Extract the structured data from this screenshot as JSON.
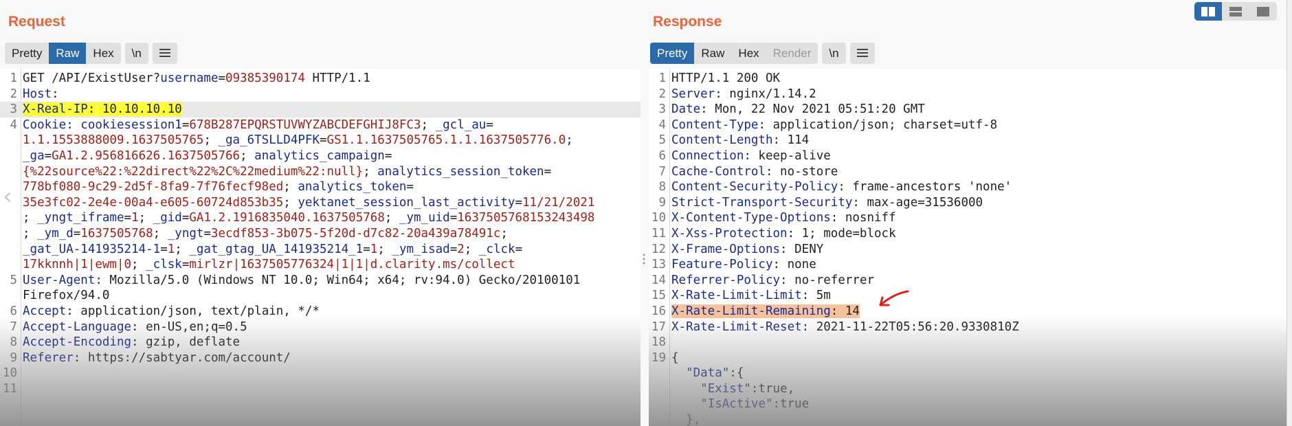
{
  "request": {
    "title": "Request",
    "tabs": [
      {
        "label": "Pretty",
        "active": false
      },
      {
        "label": "Raw",
        "active": true
      },
      {
        "label": "Hex",
        "active": false
      }
    ],
    "newline_button": "\\n",
    "menu_icon": "hamburger-menu-icon",
    "lines": [
      {
        "n": "1",
        "parts": [
          [
            "p",
            "GET /API/ExistUser?"
          ],
          [
            "k",
            "username"
          ],
          [
            "p",
            "="
          ],
          [
            "v",
            "09385390174"
          ],
          [
            "p",
            " HTTP/1.1"
          ]
        ]
      },
      {
        "n": "2",
        "parts": [
          [
            "k",
            "Host"
          ],
          [
            "p",
            ":"
          ]
        ]
      },
      {
        "n": "3",
        "cur": true,
        "highlight": "yellow",
        "parts": [
          [
            "k",
            "X-Real-IP"
          ],
          [
            "p",
            ": 10.10.10.10"
          ]
        ]
      },
      {
        "n": "4",
        "parts": [
          [
            "k",
            "Cookie"
          ],
          [
            "p",
            ": "
          ],
          [
            "k",
            "cookiesession1"
          ],
          [
            "p",
            "="
          ],
          [
            "v",
            "678B287EPQRSTUVWYZABCDEFGHIJ8FC3"
          ],
          [
            "p",
            "; "
          ],
          [
            "k",
            "_gcl_au"
          ],
          [
            "p",
            "="
          ]
        ]
      },
      {
        "n": "",
        "parts": [
          [
            "v",
            "1.1.1553888009.1637505765"
          ],
          [
            "p",
            "; "
          ],
          [
            "k",
            "_ga_6TSLLD4PFK"
          ],
          [
            "p",
            "="
          ],
          [
            "v",
            "GS1.1.1637505765.1.1.1637505776.0"
          ],
          [
            "p",
            ";"
          ]
        ]
      },
      {
        "n": "",
        "parts": [
          [
            "k",
            "_ga"
          ],
          [
            "p",
            "="
          ],
          [
            "v",
            "GA1.2.956816626.1637505766"
          ],
          [
            "p",
            "; "
          ],
          [
            "k",
            "analytics_campaign"
          ],
          [
            "p",
            "="
          ]
        ]
      },
      {
        "n": "",
        "parts": [
          [
            "v",
            "{%22source%22:%22direct%22%2C%22medium%22:null}"
          ],
          [
            "p",
            "; "
          ],
          [
            "k",
            "analytics_session_token"
          ],
          [
            "p",
            "="
          ]
        ]
      },
      {
        "n": "",
        "parts": [
          [
            "v",
            "778bf080-9c29-2d5f-8fa9-7f76fecf98ed"
          ],
          [
            "p",
            "; "
          ],
          [
            "k",
            "analytics_token"
          ],
          [
            "p",
            "="
          ]
        ]
      },
      {
        "n": "",
        "parts": [
          [
            "v",
            "35e3fc02-2e4e-00a4-e605-60724d853b35"
          ],
          [
            "p",
            "; "
          ],
          [
            "k",
            "yektanet_session_last_activity"
          ],
          [
            "p",
            "="
          ],
          [
            "v",
            "11/21/2021"
          ]
        ]
      },
      {
        "n": "",
        "parts": [
          [
            "p",
            "; "
          ],
          [
            "k",
            "_yngt_iframe"
          ],
          [
            "p",
            "="
          ],
          [
            "v",
            "1"
          ],
          [
            "p",
            "; "
          ],
          [
            "k",
            "_gid"
          ],
          [
            "p",
            "="
          ],
          [
            "v",
            "GA1.2.1916835040.1637505768"
          ],
          [
            "p",
            "; "
          ],
          [
            "k",
            "_ym_uid"
          ],
          [
            "p",
            "="
          ],
          [
            "v",
            "1637505768153243498"
          ]
        ]
      },
      {
        "n": "",
        "parts": [
          [
            "p",
            "; "
          ],
          [
            "k",
            "_ym_d"
          ],
          [
            "p",
            "="
          ],
          [
            "v",
            "1637505768"
          ],
          [
            "p",
            "; "
          ],
          [
            "k",
            "_yngt"
          ],
          [
            "p",
            "="
          ],
          [
            "v",
            "3ecdf853-3b075-5f20d-d7c82-20a439a78491c"
          ],
          [
            "p",
            ";"
          ]
        ]
      },
      {
        "n": "",
        "parts": [
          [
            "k",
            "_gat_UA-141935214-1"
          ],
          [
            "p",
            "="
          ],
          [
            "v",
            "1"
          ],
          [
            "p",
            "; "
          ],
          [
            "k",
            "_gat_gtag_UA_141935214_1"
          ],
          [
            "p",
            "="
          ],
          [
            "v",
            "1"
          ],
          [
            "p",
            "; "
          ],
          [
            "k",
            "_ym_isad"
          ],
          [
            "p",
            "="
          ],
          [
            "v",
            "2"
          ],
          [
            "p",
            "; "
          ],
          [
            "k",
            "_clck"
          ],
          [
            "p",
            "="
          ]
        ]
      },
      {
        "n": "",
        "parts": [
          [
            "v",
            "17kknnh|1|ewm|0"
          ],
          [
            "p",
            "; "
          ],
          [
            "k",
            "_clsk"
          ],
          [
            "p",
            "="
          ],
          [
            "v",
            "mirlzr|1637505776324|1|1|d.clarity.ms/collect"
          ]
        ]
      },
      {
        "n": "5",
        "parts": [
          [
            "k",
            "User-Agent"
          ],
          [
            "p",
            ": Mozilla/5.0 (Windows NT 10.0; Win64; x64; rv:94.0) Gecko/20100101"
          ]
        ]
      },
      {
        "n": "",
        "parts": [
          [
            "p",
            "Firefox/94.0"
          ]
        ]
      },
      {
        "n": "6",
        "parts": [
          [
            "k",
            "Accept"
          ],
          [
            "p",
            ": application/json, text/plain, */*"
          ]
        ]
      },
      {
        "n": "7",
        "parts": [
          [
            "k",
            "Accept-Language"
          ],
          [
            "p",
            ": en-US,en;q=0.5"
          ]
        ]
      },
      {
        "n": "8",
        "parts": [
          [
            "k",
            "Accept-Encoding"
          ],
          [
            "p",
            ": gzip, deflate"
          ]
        ]
      },
      {
        "n": "9",
        "parts": [
          [
            "k",
            "Referer"
          ],
          [
            "p",
            ": https://sabtyar.com/account/"
          ]
        ]
      },
      {
        "n": "10",
        "parts": []
      },
      {
        "n": "11",
        "parts": []
      }
    ]
  },
  "response": {
    "title": "Response",
    "tabs": [
      {
        "label": "Pretty",
        "active": true
      },
      {
        "label": "Raw",
        "active": false
      },
      {
        "label": "Hex",
        "active": false
      },
      {
        "label": "Render",
        "active": false,
        "disabled": true
      }
    ],
    "newline_button": "\\n",
    "menu_icon": "hamburger-menu-icon",
    "lines": [
      {
        "n": "1",
        "parts": [
          [
            "p",
            "HTTP/1.1 200 OK"
          ]
        ]
      },
      {
        "n": "2",
        "parts": [
          [
            "k",
            "Server"
          ],
          [
            "p",
            ": nginx/1.14.2"
          ]
        ]
      },
      {
        "n": "3",
        "parts": [
          [
            "k",
            "Date"
          ],
          [
            "p",
            ": Mon, 22 Nov 2021 05:51:20 GMT"
          ]
        ]
      },
      {
        "n": "4",
        "parts": [
          [
            "k",
            "Content-Type"
          ],
          [
            "p",
            ": application/json; charset=utf-8"
          ]
        ]
      },
      {
        "n": "5",
        "parts": [
          [
            "k",
            "Content-Length"
          ],
          [
            "p",
            ": 114"
          ]
        ]
      },
      {
        "n": "6",
        "parts": [
          [
            "k",
            "Connection"
          ],
          [
            "p",
            ": keep-alive"
          ]
        ]
      },
      {
        "n": "7",
        "parts": [
          [
            "k",
            "Cache-Control"
          ],
          [
            "p",
            ": no-store"
          ]
        ]
      },
      {
        "n": "8",
        "parts": [
          [
            "k",
            "Content-Security-Policy"
          ],
          [
            "p",
            ": frame-ancestors 'none'"
          ]
        ]
      },
      {
        "n": "9",
        "parts": [
          [
            "k",
            "Strict-Transport-Security"
          ],
          [
            "p",
            ": max-age=31536000"
          ]
        ]
      },
      {
        "n": "10",
        "parts": [
          [
            "k",
            "X-Content-Type-Options"
          ],
          [
            "p",
            ": nosniff"
          ]
        ]
      },
      {
        "n": "11",
        "parts": [
          [
            "k",
            "X-Xss-Protection"
          ],
          [
            "p",
            ": 1; mode=block"
          ]
        ]
      },
      {
        "n": "12",
        "parts": [
          [
            "k",
            "X-Frame-Options"
          ],
          [
            "p",
            ": DENY"
          ]
        ]
      },
      {
        "n": "13",
        "parts": [
          [
            "k",
            "Feature-Policy"
          ],
          [
            "p",
            ": none"
          ]
        ]
      },
      {
        "n": "14",
        "parts": [
          [
            "k",
            "Referrer-Policy"
          ],
          [
            "p",
            ": no-referrer"
          ]
        ]
      },
      {
        "n": "15",
        "parts": [
          [
            "k",
            "X-Rate-Limit-Limit"
          ],
          [
            "p",
            ": 5m"
          ]
        ]
      },
      {
        "n": "16",
        "highlight": "orange",
        "parts": [
          [
            "k",
            "X-Rate-Limit-Remaining"
          ],
          [
            "p",
            ": 14"
          ]
        ]
      },
      {
        "n": "17",
        "parts": [
          [
            "k",
            "X-Rate-Limit-Reset"
          ],
          [
            "p",
            ": 2021-11-22T05:56:20.9330810Z"
          ]
        ]
      },
      {
        "n": "18",
        "parts": []
      },
      {
        "n": "19",
        "parts": [
          [
            "p",
            "{"
          ]
        ]
      },
      {
        "n": "",
        "parts": [
          [
            "p",
            "  "
          ],
          [
            "k",
            "\"Data\""
          ],
          [
            "p",
            ":{"
          ]
        ]
      },
      {
        "n": "",
        "parts": [
          [
            "p",
            "    "
          ],
          [
            "k",
            "\"Exist\""
          ],
          [
            "p",
            ":true,"
          ]
        ]
      },
      {
        "n": "",
        "parts": [
          [
            "p",
            "    "
          ],
          [
            "k",
            "\"IsActive\""
          ],
          [
            "p",
            ":true"
          ]
        ]
      },
      {
        "n": "",
        "parts": [
          [
            "p",
            "  },"
          ]
        ]
      }
    ]
  },
  "layout_toggle": {
    "options": [
      {
        "name": "side-by-side",
        "active": true
      },
      {
        "name": "top-bottom",
        "active": false
      },
      {
        "name": "single",
        "active": false
      }
    ]
  },
  "colors": {
    "title": "#e8643a",
    "active_tab": "#2a6aa8",
    "header_key": "#1b2a8f",
    "param_value": "#a3201a",
    "highlight_yellow": "#ffff36",
    "highlight_orange": "#f6c29b",
    "annotation_arrow": "#e0221a"
  }
}
